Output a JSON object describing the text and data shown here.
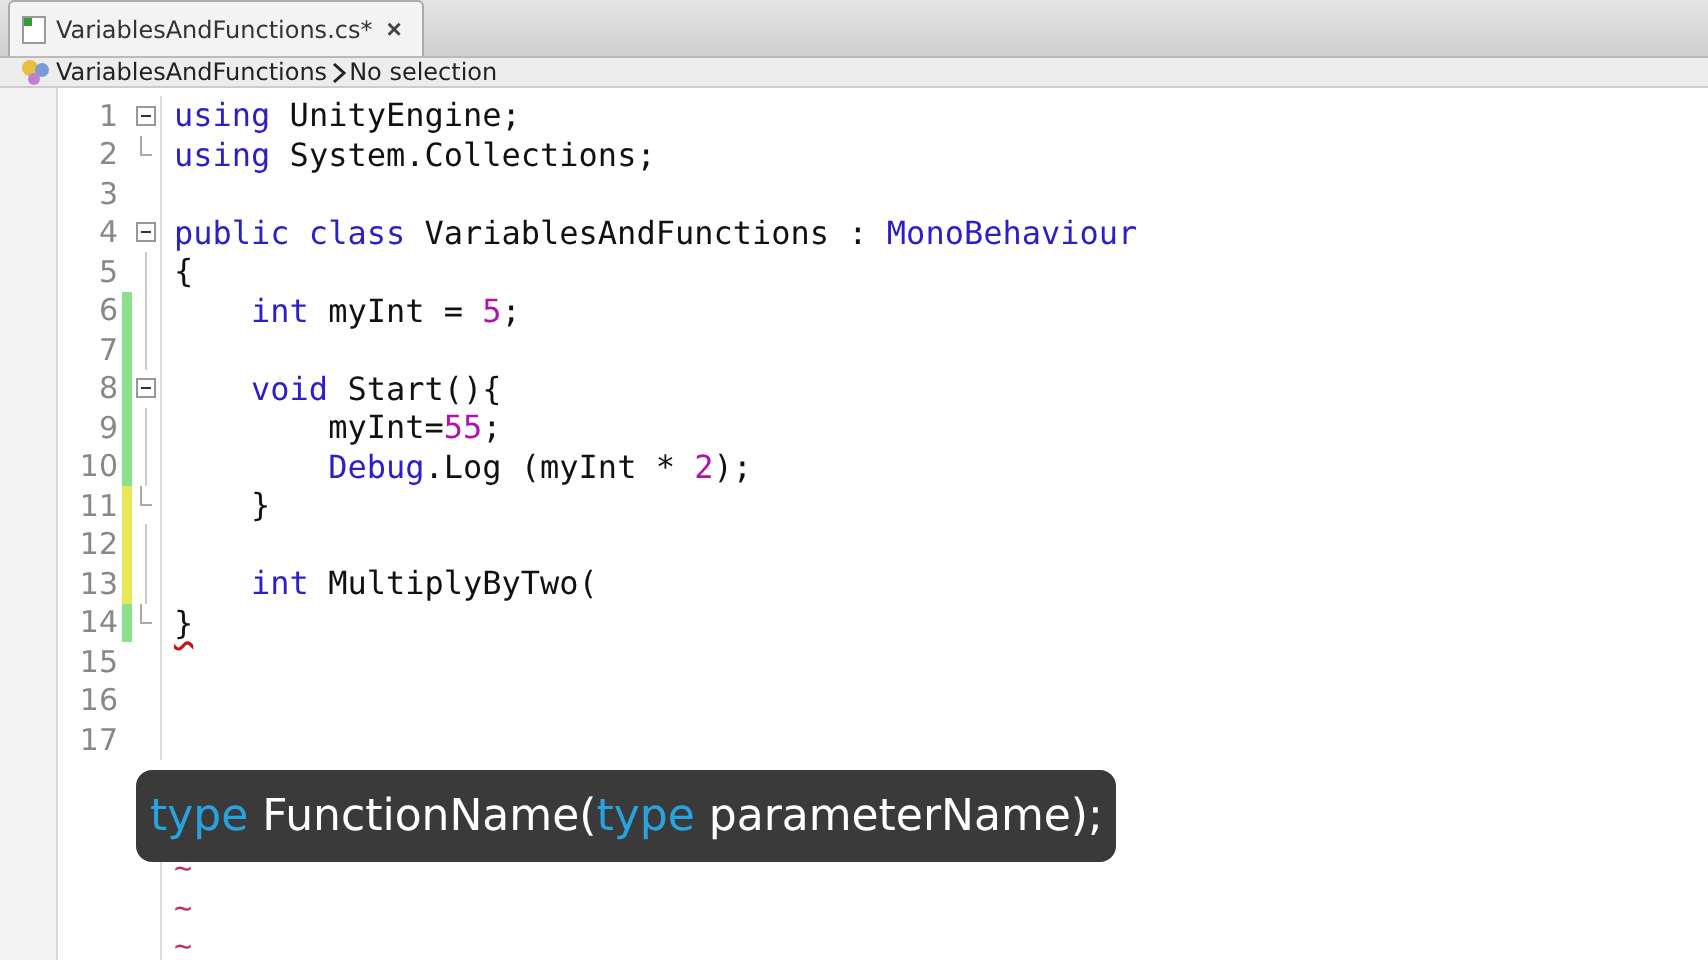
{
  "tab": {
    "title": "VariablesAndFunctions.cs*",
    "close": "×",
    "selected": true
  },
  "breadcrumb": {
    "items": [
      "VariablesAndFunctions",
      "No selection"
    ]
  },
  "lines": [
    {
      "number": "1",
      "fold_start": true,
      "tokens": [
        {
          "text": "using",
          "kind": "keyword"
        },
        {
          "text": " UnityEngine;",
          "kind": "plain"
        }
      ]
    },
    {
      "number": "2",
      "fold_end": true,
      "tokens": [
        {
          "text": "using",
          "kind": "keyword"
        },
        {
          "text": " System.Collections;",
          "kind": "plain"
        }
      ]
    },
    {
      "number": "3"
    },
    {
      "number": "4",
      "fold_start": true,
      "tokens": [
        {
          "text": "public",
          "kind": "keyword"
        },
        {
          "text": " class",
          "kind": "keyword"
        },
        {
          "text": " VariablesAndFunctions : ",
          "kind": "plain"
        },
        {
          "text": "MonoBehaviour",
          "kind": "keyword"
        }
      ]
    },
    {
      "number": "5",
      "in_block": true,
      "tokens": [
        {
          "text": "{",
          "kind": "plain"
        }
      ]
    },
    {
      "number": "6",
      "in_block": true,
      "modified": false,
      "tokens": [
        {
          "text": "    int",
          "kind": "keyword"
        },
        {
          "text": " myInt = ",
          "kind": "plain"
        },
        {
          "text": "5",
          "kind": "number"
        },
        {
          "text": ";",
          "kind": "plain"
        }
      ]
    },
    {
      "number": "7",
      "in_block": true,
      "modified": false
    },
    {
      "number": "8",
      "fold_start": true,
      "modified": false,
      "tokens": [
        {
          "text": "    void",
          "kind": "keyword"
        },
        {
          "text": " Start(){",
          "kind": "plain"
        }
      ]
    },
    {
      "number": "9",
      "in_block": true,
      "modified": false,
      "tokens": [
        {
          "text": "        myInt=",
          "kind": "plain"
        },
        {
          "text": "55",
          "kind": "number"
        },
        {
          "text": ";",
          "kind": "plain"
        }
      ]
    },
    {
      "number": "10",
      "in_block": true,
      "modified": false,
      "tokens": [
        {
          "text": "        Debug",
          "kind": "keyword"
        },
        {
          "text": ".Log (myInt * ",
          "kind": "plain"
        },
        {
          "text": "2",
          "kind": "number"
        },
        {
          "text": ");",
          "kind": "plain"
        }
      ]
    },
    {
      "number": "11",
      "fold_end": true,
      "modified": true,
      "tokens": [
        {
          "text": "    }",
          "kind": "plain"
        }
      ]
    },
    {
      "number": "12",
      "in_block": true,
      "modified": true
    },
    {
      "number": "13",
      "in_block": true,
      "modified": true,
      "tokens": [
        {
          "text": "    int",
          "kind": "keyword"
        },
        {
          "text": " MultiplyByTwo(",
          "kind": "plain"
        }
      ]
    },
    {
      "number": "14",
      "fold_end": true,
      "modified": false,
      "tokens": [
        {
          "text": "}",
          "kind": "plain",
          "error": true
        }
      ]
    },
    {
      "number": "15"
    },
    {
      "number": "16"
    },
    {
      "number": "17"
    }
  ],
  "empty_lines": [
    "~",
    "~",
    "~"
  ],
  "caption": {
    "tokens": [
      {
        "text": "type",
        "kind": "keyword"
      },
      {
        "text": " FunctionName(",
        "kind": "plain"
      },
      {
        "text": "type",
        "kind": "keyword"
      },
      {
        "text": " parameterName);",
        "kind": "plain"
      }
    ]
  }
}
